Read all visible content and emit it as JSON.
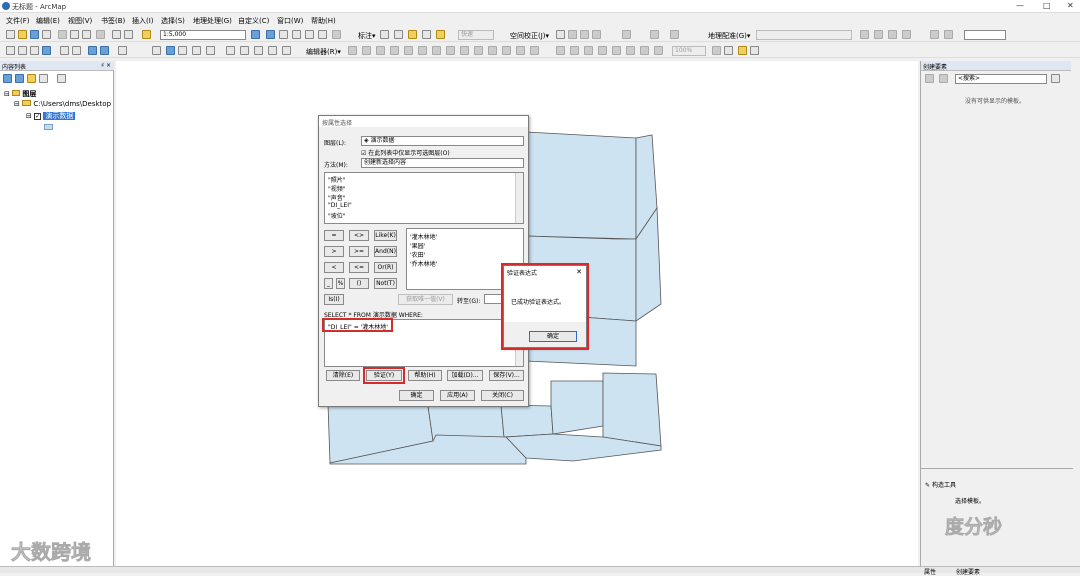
{
  "window": {
    "title": "无标题 - ArcMap",
    "min": "—",
    "max": "□",
    "close": "✕"
  },
  "menu": [
    "文件(F)",
    "编辑(E)",
    "视图(V)",
    "书签(B)",
    "插入(I)",
    "选择(S)",
    "地理处理(G)",
    "自定义(C)",
    "窗口(W)",
    "帮助(H)"
  ],
  "toolbar1": {
    "scale": "1:5,000",
    "label_marker": "标注▾",
    "fast_combo": "快速",
    "spatial_adjust": "空间校正(J)▾",
    "georef": "地理配准(G)▾"
  },
  "toolbar2": {
    "editor": "编辑器(R)▾",
    "zoom": "100%"
  },
  "toc": {
    "header": "内容列表",
    "pin": "♯ ×",
    "root": "图层",
    "path": "C:\\Users\\dms\\Desktop",
    "layer": "演示数据"
  },
  "right_panel": {
    "header": "创建要素",
    "search_placeholder": "<搜索>",
    "empty_msg": "没有可供显示的模板。",
    "construct_header": "构造工具",
    "construct_msg": "选择模板。",
    "tab_attr": "属性",
    "tab_create": "创建要素"
  },
  "dialog": {
    "title": "按属性选择",
    "layer_label": "图层(L):",
    "layer_value": "演示数据",
    "checkbox_label": "在此列表中仅显示可选图层(O)",
    "method_label": "方法(M):",
    "method_value": "创建新选择内容",
    "fields": [
      "\"照片\"",
      "\"视频\"",
      "\"声音\"",
      "\"DI_LEI\"",
      "\"坡位\""
    ],
    "ops": [
      [
        "=",
        "<>",
        "Like(K)"
      ],
      [
        ">",
        ">=",
        "And(N)"
      ],
      [
        "<",
        "<=",
        "Or(R)"
      ],
      [
        "_",
        "%",
        "()",
        "Not(T)"
      ]
    ],
    "is_btn": "Is(I)",
    "unique_btn": "获取唯一值(V)",
    "goto_label": "转至(G):",
    "values": [
      "'灌木林地'",
      "'果园'",
      "'农田'",
      "'乔木林地'"
    ],
    "sql_label": "SELECT * FROM 演示数据 WHERE:",
    "expression": "\"DI_LEI\" = '灌木林地'",
    "btn_clear": "清除(E)",
    "btn_verify": "验证(Y)",
    "btn_help": "帮助(H)",
    "btn_load": "加载(D)...",
    "btn_save": "保存(V)...",
    "btn_ok": "确定",
    "btn_apply": "应用(A)",
    "btn_close": "关闭(C)"
  },
  "verify": {
    "title": "验证表达式",
    "message": "已成功验证表达式。",
    "ok": "确定",
    "close": "✕"
  },
  "watermarks": {
    "left": "大数跨境",
    "right": "度分秒"
  }
}
